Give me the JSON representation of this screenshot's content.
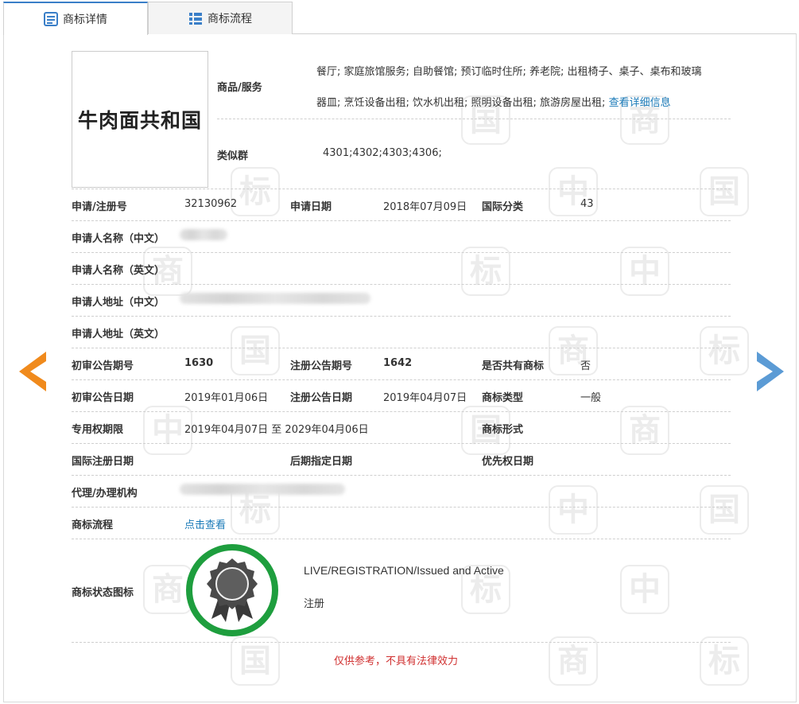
{
  "tabs": [
    {
      "label": "商标详情",
      "icon": "document-list-icon",
      "active": true
    },
    {
      "label": "商标流程",
      "icon": "grid-list-icon",
      "active": false
    }
  ],
  "logo_text": "牛肉面共和国",
  "goods_services": {
    "label": "商品/服务",
    "line1": "餐厅; 家庭旅馆服务; 自助餐馆; 预订临时住所; 养老院; 出租椅子、桌子、桌布和玻璃",
    "line2": "器皿; 烹饪设备出租; 饮水机出租; 照明设备出租; 旅游房屋出租;",
    "more_link": "查看详细信息"
  },
  "similar_groups": {
    "label": "类似群",
    "value": "4301;4302;4303;4306;"
  },
  "fields": {
    "reg_no_label": "申请/注册号",
    "reg_no": "32130962",
    "app_date_label": "申请日期",
    "app_date": "2018年07月09日",
    "intl_class_label": "国际分类",
    "intl_class": "43",
    "applicant_cn_label": "申请人名称（中文）",
    "applicant_en_label": "申请人名称（英文）",
    "address_cn_label": "申请人地址（中文）",
    "address_en_label": "申请人地址（英文）",
    "prelim_no_label": "初审公告期号",
    "prelim_no": "1630",
    "reg_pub_no_label": "注册公告期号",
    "reg_pub_no": "1642",
    "shared_label": "是否共有商标",
    "shared": "否",
    "prelim_date_label": "初审公告日期",
    "prelim_date": "2019年01月06日",
    "reg_pub_date_label": "注册公告日期",
    "reg_pub_date": "2019年04月07日",
    "tm_type_label": "商标类型",
    "tm_type": "一般",
    "exclusive_label": "专用权期限",
    "exclusive": "2019年04月07日 至 2029年04月06日",
    "tm_form_label": "商标形式",
    "intl_reg_date_label": "国际注册日期",
    "later_date_label": "后期指定日期",
    "priority_date_label": "优先权日期",
    "agent_label": "代理/办理机构",
    "process_label": "商标流程",
    "process_link": "点击查看",
    "status_icon_label": "商标状态图标",
    "status_en": "LIVE/REGISTRATION/Issued and Active",
    "status_cn": "注册"
  },
  "disclaimer": "仅供参考，不具有法律效力",
  "watermark_chars": [
    "中",
    "国",
    "商",
    "标"
  ],
  "colors": {
    "accent": "#3a7fc8",
    "link": "#1a7ab8",
    "prev_arrow": "#f08a1c",
    "next_arrow": "#5b9bd5",
    "status_ring": "#1e9e3e",
    "disclaimer": "#d03030"
  }
}
